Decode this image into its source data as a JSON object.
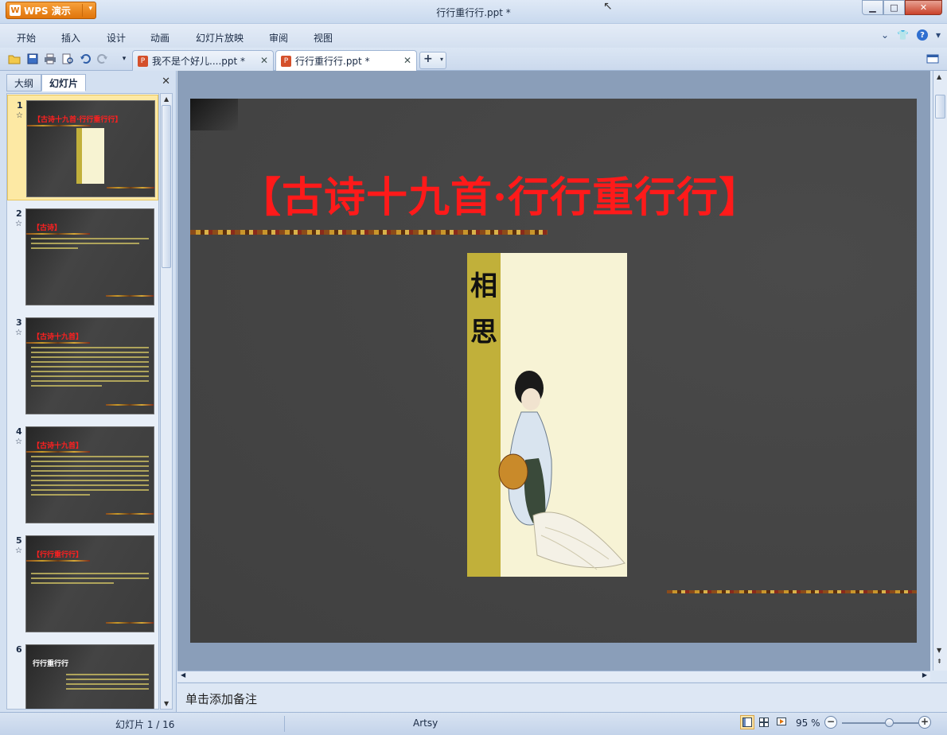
{
  "window": {
    "app_button": "WPS 演示",
    "title": "行行重行行.ppt *",
    "controls": {
      "minimize": "▁",
      "maximize": "□",
      "close": "✕"
    }
  },
  "menu": {
    "items": [
      "开始",
      "插入",
      "设计",
      "动画",
      "幻灯片放映",
      "审阅",
      "视图"
    ]
  },
  "tabs": [
    {
      "label": "我不是个好儿....ppt *",
      "active": false
    },
    {
      "label": "行行重行行.ppt *",
      "active": true
    }
  ],
  "left_panel": {
    "tabs": [
      "大纲",
      "幻灯片"
    ],
    "active_tab": "幻灯片",
    "thumbnails": [
      {
        "num": "1",
        "title": "【古诗十九首·行行重行行】",
        "selected": true
      },
      {
        "num": "2",
        "title": "【古诗】",
        "selected": false
      },
      {
        "num": "3",
        "title": "【古诗十九首】",
        "selected": false
      },
      {
        "num": "4",
        "title": "【古诗十九首】",
        "selected": false
      },
      {
        "num": "5",
        "title": "【行行重行行】",
        "selected": false
      },
      {
        "num": "6",
        "title": "行行重行行",
        "selected": false
      }
    ]
  },
  "slide": {
    "title": "【古诗十九首·行行重行行】",
    "picture_chars": [
      "相",
      "思"
    ]
  },
  "notes": {
    "placeholder": "单击添加备注"
  },
  "status": {
    "slide_count": "幻灯片 1 / 16",
    "theme": "Artsy",
    "zoom": "95 %",
    "zoom_value": 95
  },
  "colors": {
    "title_red": "#ff1a1a",
    "wps_orange": "#e0740a",
    "slide_bg": "#444444",
    "picture_strip": "#c1b03a"
  }
}
